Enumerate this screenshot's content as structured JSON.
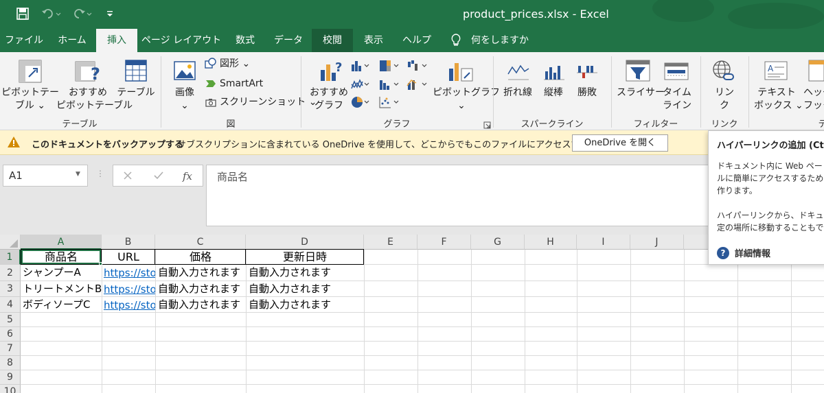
{
  "titlebar": {
    "title": "product_prices.xlsx  -  Excel",
    "bg_color": "#217346"
  },
  "qat": {
    "save_icon": "save-icon",
    "undo_icon": "undo-icon",
    "redo_icon": "redo-icon",
    "customize_icon": "customize-qat-icon"
  },
  "tabs": [
    {
      "label": "ファイル"
    },
    {
      "label": "ホーム"
    },
    {
      "label": "挿入"
    },
    {
      "label": "ページ レイアウト"
    },
    {
      "label": "数式"
    },
    {
      "label": "データ"
    },
    {
      "label": "校閲"
    },
    {
      "label": "表示"
    },
    {
      "label": "ヘルプ"
    }
  ],
  "tell_me": "何をしますか",
  "ribbon": {
    "pivottable": "ピボットテー\nブル ⌄",
    "pivottable_l1": "ピボットテー",
    "pivottable_l2": "ブル ⌄",
    "recommended_pivot_l1": "おすすめ",
    "recommended_pivot_l2": "ピボットテーブル",
    "table": "テーブル",
    "group_table": "テーブル",
    "image_l1": "画像",
    "image_l2": "⌄",
    "shapes": "図形 ⌄",
    "smartart": "SmartArt",
    "screenshot": "スクリーンショット ⌄",
    "group_figure": "図",
    "recommended_chart_l1": "おすすめ",
    "recommended_chart_l2": "グラフ",
    "pivotchart_l1": "ピボットグラフ",
    "pivotchart_l2": "⌄",
    "group_chart": "グラフ",
    "spark_line": "折れ線",
    "spark_column": "縦棒",
    "spark_winloss": "勝敗",
    "group_sparkline": "スパークライン",
    "slicer": "スライサー",
    "timeline_l1": "タイム",
    "timeline_l2": "ライン",
    "group_filter": "フィルター",
    "link_l1": "リン",
    "link_l2": "ク",
    "group_link": "リンク",
    "textbox_l1": "テキスト",
    "textbox_l2": "ボックス ⌄",
    "header_l1": "ヘッダー",
    "header_l2": "フッター",
    "group_text": "テ"
  },
  "message_bar": {
    "title": "このドキュメントをバックアップする",
    "text": "サブスクリプションに含まれている OneDrive を使用して、どこからでもこのファイルにアクセスできます。",
    "button": "OneDrive を開く",
    "bg_color": "#fff4ce"
  },
  "formula_bar": {
    "name_box": "A1",
    "content": "商品名"
  },
  "sheet": {
    "columns": [
      "A",
      "B",
      "C",
      "D",
      "E",
      "F",
      "G",
      "H",
      "I",
      "J"
    ],
    "rows": [
      "1",
      "2",
      "3",
      "4",
      "5",
      "6",
      "7",
      "8",
      "9",
      "10"
    ],
    "header_row": [
      "商品名",
      "URL",
      "価格",
      "更新日時"
    ],
    "data_rows": [
      [
        "シャンプーA",
        "https://sto",
        "自動入力されます",
        "自動入力されます"
      ],
      [
        "トリートメントB",
        "https://sto",
        "自動入力されます",
        "自動入力されます"
      ],
      [
        "ボディソープC",
        "https://sto",
        "自動入力されます",
        "自動入力されます"
      ]
    ]
  },
  "tooltip": {
    "title": "ハイパーリンクの追加 (Ct",
    "line1": "ドキュメント内に Web ペー",
    "line2": "ルに簡単にアクセスするため",
    "line3": "作ります。",
    "line4": "ハイパーリンクから、ドキュメン",
    "line5": "定の場所に移動することもで",
    "more": "詳細情報"
  }
}
